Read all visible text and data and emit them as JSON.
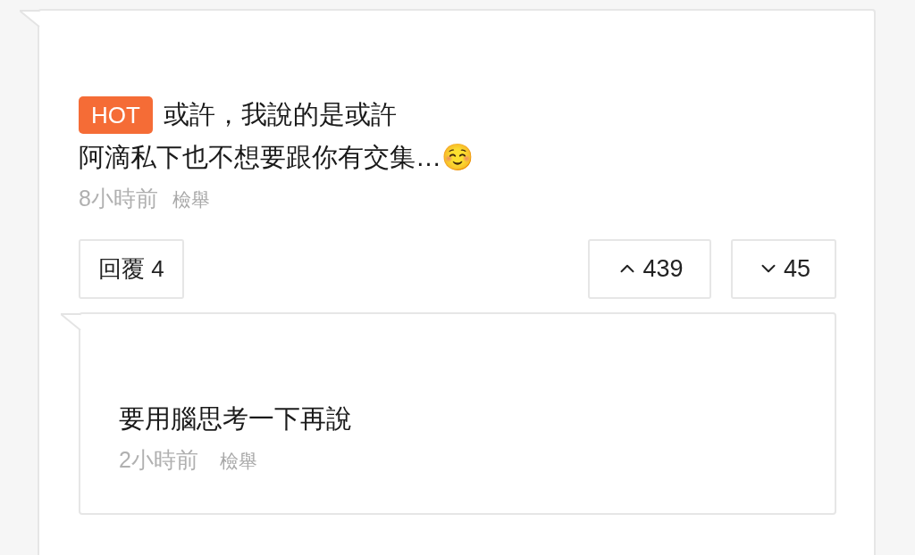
{
  "comment": {
    "badge": "HOT",
    "lines": [
      "或許，我說的是或許",
      "阿滴私下也不想要跟你有交集…☺️"
    ],
    "time": "8小時前",
    "report": "檢舉",
    "reply_button": "回覆 4",
    "upvotes": "439",
    "downvotes": "45"
  },
  "replies": [
    {
      "text": "要用腦思考一下再說",
      "time": "2小時前",
      "report": "檢舉"
    }
  ]
}
